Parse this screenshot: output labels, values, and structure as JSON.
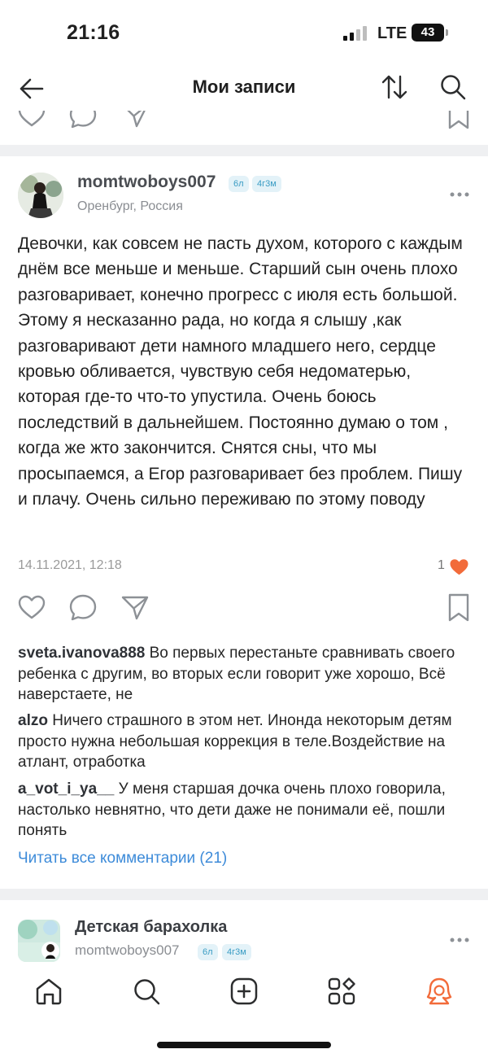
{
  "status_bar": {
    "time": "21:16",
    "network": "LTE",
    "battery": "43"
  },
  "header": {
    "title": "Мои записи",
    "icons": [
      "back-arrow-icon",
      "sort-icon",
      "search-icon"
    ]
  },
  "post": {
    "author": "momtwoboys007",
    "badges": [
      "6л",
      "4г3м"
    ],
    "location": "Оренбург, Россия",
    "text": "Девочки, как совсем не пасть духом, которого с каждым днём все меньше и меньше. Старший сын очень плохо разговаривает, конечно прогресс с июля есть большой. Этому я несказанно рада, но когда я слышу ,как разговаривают дети намного младшего него, сердце кровью обливается, чувствую себя недоматерью, которая где-то что-то упустила. Очень боюсь последствий в дальнейшем. Постоянно думаю о том , когда же жто закончится. Снятся сны, что мы просыпаемся, а Егор разговаривает без проблем. Пишу и плачу. Очень сильно переживаю по этому поводу",
    "date": "14.11.2021, 12:18",
    "likes": "1",
    "comments": [
      {
        "author": "sveta.ivanova888",
        "text": "Во первых перестаньте сравнивать своего ребенка с другим, во вторых если говорит уже хорошо, Всё наверстаете, не"
      },
      {
        "author": "alzo",
        "text": "Ничего страшного в этом нет. Инонда некоторым детям просто нужна небольшая коррекция в теле.Воздействие на атлант, отработка"
      },
      {
        "author": "a_vot_i_ya__",
        "text": "У меня старшая дочка очень плохо говорила, настолько невнятно, что дети даже не понимали её, пошли понять"
      }
    ],
    "read_all": "Читать все комментарии (21)"
  },
  "next_post": {
    "title": "Детская барахолка",
    "author": "momtwoboys007",
    "badges": [
      "6л",
      "4г3м"
    ]
  },
  "tabbar": {
    "items": [
      "home-icon",
      "search-icon",
      "add-post-icon",
      "services-icon",
      "profile-icon"
    ],
    "active_color": "#f26b3a"
  }
}
